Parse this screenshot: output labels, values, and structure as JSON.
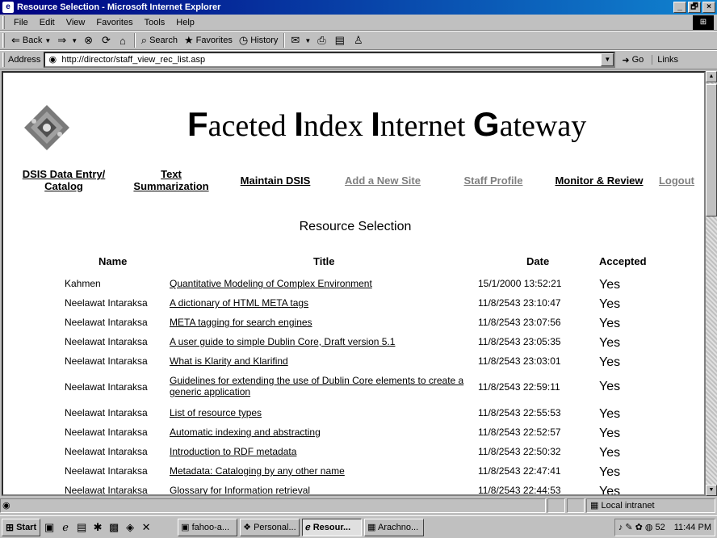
{
  "window": {
    "title": "Resource Selection - Microsoft Internet Explorer",
    "controls": [
      "_",
      "🗗",
      "×"
    ]
  },
  "menu": [
    "File",
    "Edit",
    "View",
    "Favorites",
    "Tools",
    "Help"
  ],
  "toolbar": {
    "back": "Back",
    "search": "Search",
    "favorites": "Favorites",
    "history": "History"
  },
  "address": {
    "label": "Address",
    "url": "http://director/staff_view_rec_list.asp",
    "go": "Go",
    "links": "Links"
  },
  "page": {
    "title_parts": [
      {
        "big": "F",
        "rest": "aceted "
      },
      {
        "big": "I",
        "rest": "ndex "
      },
      {
        "big": "I",
        "rest": "nternet "
      },
      {
        "big": "G",
        "rest": "ateway"
      }
    ],
    "nav": [
      {
        "line1": "DSIS Data Entry/",
        "line2": "Catalog"
      },
      {
        "line1": "Text",
        "line2": "Summarization"
      },
      {
        "line1": "Maintain DSIS",
        "line2": ""
      },
      {
        "line1": "Add a New Site",
        "line2": ""
      },
      {
        "line1": "Staff Profile",
        "line2": ""
      },
      {
        "line1": "Monitor & Review",
        "line2": ""
      },
      {
        "line1": "Logout",
        "line2": ""
      }
    ],
    "section_title": "Resource Selection",
    "columns": [
      "Name",
      "Title",
      "Date",
      "Accepted"
    ],
    "rows": [
      {
        "name": "Kahmen",
        "title": "Quantitative Modeling of Complex Environment",
        "date": "15/1/2000 13:52:21",
        "accepted": "Yes"
      },
      {
        "name": "Neelawat Intaraksa",
        "title": "A dictionary of HTML META tags",
        "date": "11/8/2543 23:10:47",
        "accepted": "Yes"
      },
      {
        "name": "Neelawat Intaraksa",
        "title": "META tagging for search engines",
        "date": "11/8/2543 23:07:56",
        "accepted": "Yes"
      },
      {
        "name": "Neelawat Intaraksa",
        "title": "A user guide to simple Dublin Core, Draft version 5.1",
        "date": "11/8/2543 23:05:35",
        "accepted": "Yes"
      },
      {
        "name": "Neelawat Intaraksa",
        "title": "What is Klarity and Klarifind",
        "date": "11/8/2543 23:03:01",
        "accepted": "Yes"
      },
      {
        "name": "Neelawat Intaraksa",
        "title": "Guidelines for extending the use of Dublin Core elements to create a generic application",
        "date": "11/8/2543 22:59:11",
        "accepted": "Yes"
      },
      {
        "name": "Neelawat Intaraksa",
        "title": "List of resource types",
        "date": "11/8/2543 22:55:53",
        "accepted": "Yes"
      },
      {
        "name": "Neelawat Intaraksa",
        "title": "Automatic indexing and abstracting",
        "date": "11/8/2543 22:52:57",
        "accepted": "Yes"
      },
      {
        "name": "Neelawat Intaraksa",
        "title": "Introduction to RDF metadata",
        "date": "11/8/2543 22:50:32",
        "accepted": "Yes"
      },
      {
        "name": "Neelawat Intaraksa",
        "title": "Metadata: Cataloging by any other name",
        "date": "11/8/2543 22:47:41",
        "accepted": "Yes"
      },
      {
        "name": "Neelawat Intaraksa",
        "title": "Glossary for Information retrieval",
        "date": "11/8/2543 22:44:53",
        "accepted": "Yes"
      }
    ]
  },
  "status": {
    "zone": "Local intranet"
  },
  "taskbar": {
    "start": "Start",
    "tasks": [
      {
        "label": "fahoo-a...",
        "active": false
      },
      {
        "label": "Personal...",
        "active": false
      },
      {
        "label": "Resour...",
        "active": true
      },
      {
        "label": "Arachno...",
        "active": false
      }
    ],
    "tray_num": "52",
    "clock": "11:44 PM"
  },
  "icons": {
    "app": "ie-icon",
    "logo_color": "#3a8a8a"
  }
}
